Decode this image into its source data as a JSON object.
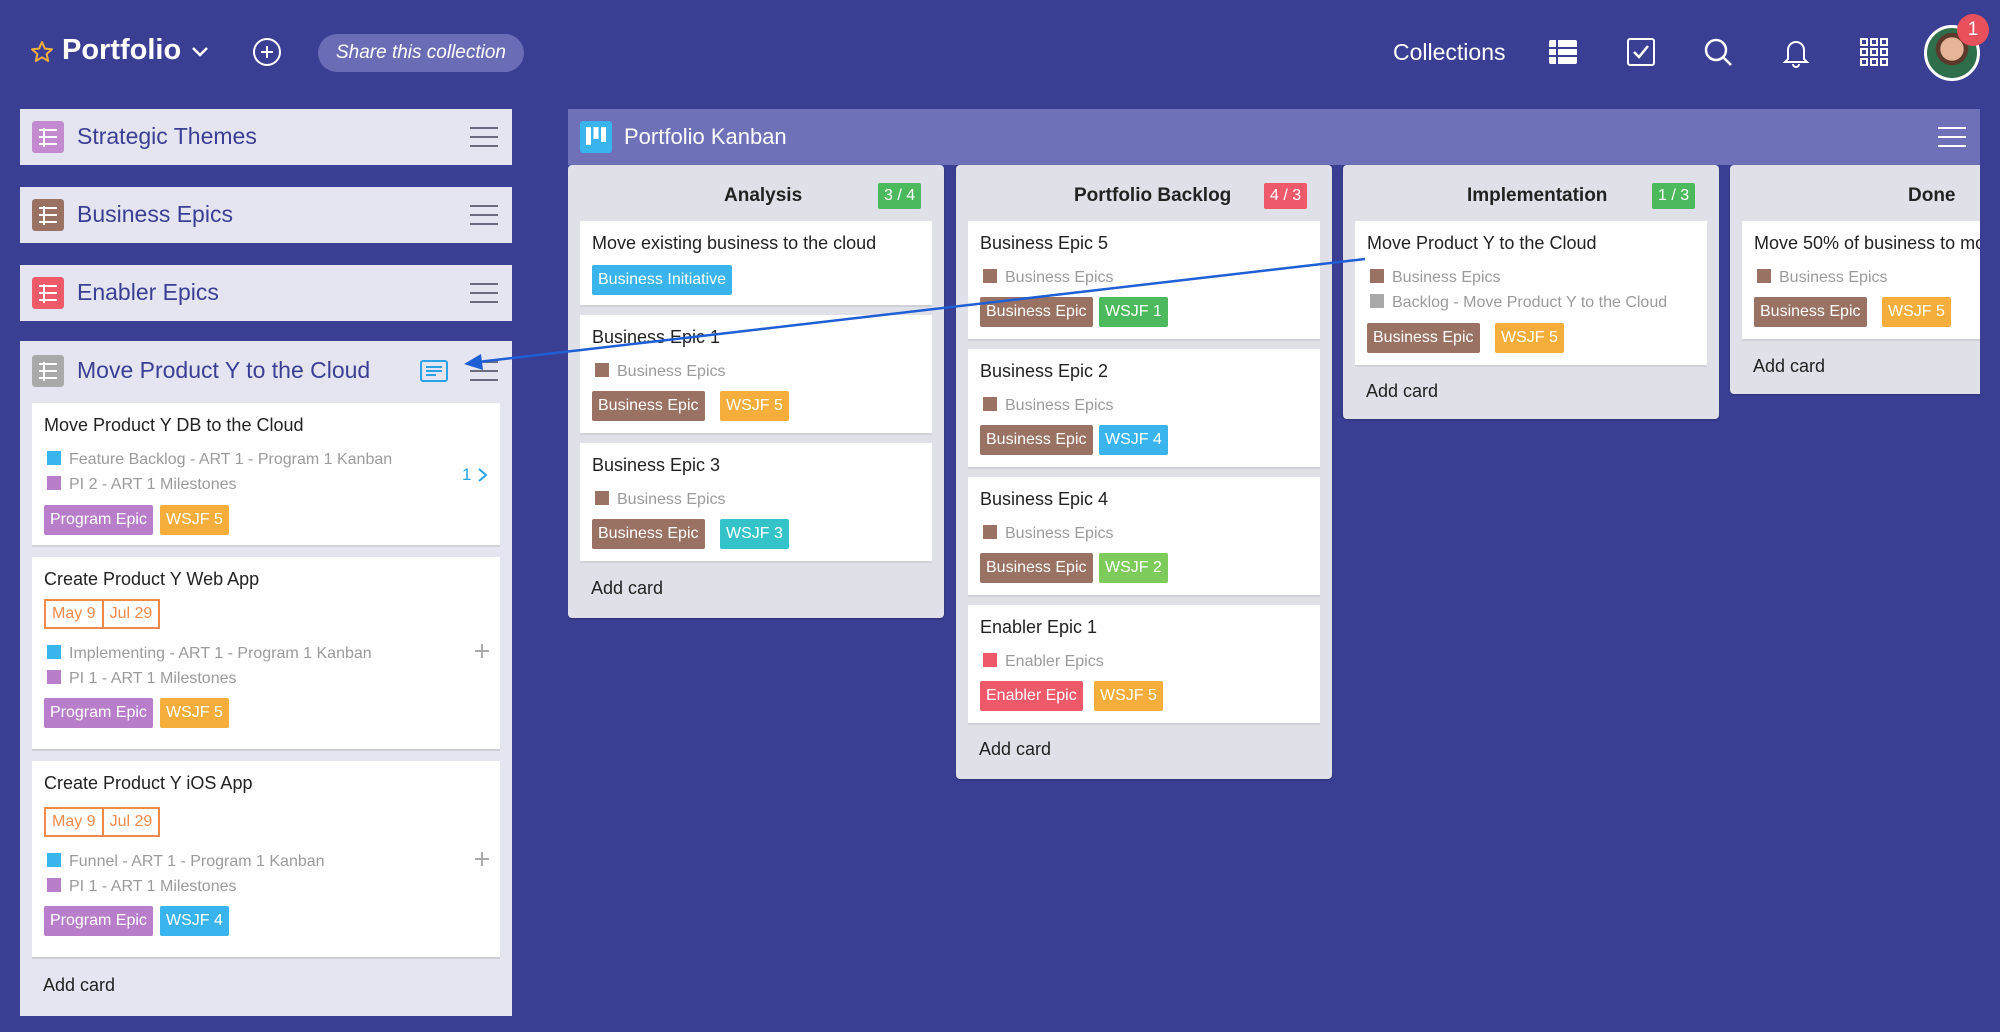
{
  "colors": {
    "background": "#3b3f94",
    "business_epic": "#9a7264",
    "enabler_epic": "#ef5a6a",
    "program_epic": "#b97ec9",
    "business_initiative": "#3ab4ec",
    "wsjf_orange": "#f5ae3b",
    "wsjf_green": "#4cba5c",
    "wsjf_blue": "#3ab4ec",
    "wsjf_teal": "#33c3c9",
    "wsjf_lime": "#7ccb5b",
    "wip_ok": "#4cba5c",
    "wip_over": "#ef5a6a",
    "connector": "#1e5fd6"
  },
  "header": {
    "title": "Portfolio",
    "share_label": "Share this collection",
    "collections_label": "Collections",
    "notification_count": "1",
    "icons": [
      "star-icon",
      "chevron-down-icon",
      "add-icon",
      "list-view-icon",
      "checkbox-icon",
      "search-icon",
      "bell-icon",
      "apps-grid-icon"
    ]
  },
  "sidebar": {
    "collapsed": [
      {
        "label": "Strategic Themes",
        "icon_color": "#c48ad0"
      },
      {
        "label": "Business Epics",
        "icon_color": "#9a7264"
      },
      {
        "label": "Enabler Epics",
        "icon_color": "#ef5a6a"
      }
    ],
    "expanded": {
      "label": "Move Product Y to the Cloud",
      "icon_color": "#a9a9a9",
      "cards": [
        {
          "title": "Move Product Y DB to the Cloud",
          "meta": [
            {
              "text": "Feature Backlog - ART 1 - Program 1 Kanban",
              "color": "#3ab4ec"
            },
            {
              "text": "PI 2 - ART 1 Milestones",
              "color": "#b97ec9"
            }
          ],
          "child_count": "1",
          "tags": [
            {
              "text": "Program Epic",
              "color": "#b97ec9"
            },
            {
              "text": "WSJF 5",
              "color": "#f5ae3b"
            }
          ]
        },
        {
          "title": "Create Product Y Web App",
          "dates": [
            "May 9",
            "Jul 29"
          ],
          "meta": [
            {
              "text": "Implementing - ART 1 - Program 1 Kanban",
              "color": "#3ab4ec"
            },
            {
              "text": "PI 1 - ART 1 Milestones",
              "color": "#b97ec9"
            }
          ],
          "tags": [
            {
              "text": "Program Epic",
              "color": "#b97ec9"
            },
            {
              "text": "WSJF 5",
              "color": "#f5ae3b"
            }
          ]
        },
        {
          "title": "Create Product Y iOS App",
          "dates": [
            "May 9",
            "Jul 29"
          ],
          "meta": [
            {
              "text": "Funnel - ART 1 - Program 1 Kanban",
              "color": "#3ab4ec"
            },
            {
              "text": "PI 1 - ART 1 Milestones",
              "color": "#b97ec9"
            }
          ],
          "tags": [
            {
              "text": "Program Epic",
              "color": "#b97ec9"
            },
            {
              "text": "WSJF 4",
              "color": "#3ab4ec"
            }
          ]
        }
      ],
      "add_card_label": "Add card"
    }
  },
  "board": {
    "title": "Portfolio Kanban",
    "add_card_label": "Add card",
    "columns": [
      {
        "title": "Analysis",
        "wip": "3 / 4",
        "wip_color": "#4cba5c",
        "cards": [
          {
            "title": "Move existing business to the cloud",
            "tags": [
              {
                "text": "Business Initiative",
                "color": "#3ab4ec"
              }
            ]
          },
          {
            "title": "Business Epic 1",
            "meta": [
              {
                "text": "Business Epics",
                "color": "#9a7264"
              }
            ],
            "tags": [
              {
                "text": "Business Epic",
                "color": "#9a7264"
              },
              {
                "text": "WSJF 5",
                "color": "#f5ae3b"
              }
            ]
          },
          {
            "title": "Business Epic 3",
            "meta": [
              {
                "text": "Business Epics",
                "color": "#9a7264"
              }
            ],
            "tags": [
              {
                "text": "Business Epic",
                "color": "#9a7264"
              },
              {
                "text": "WSJF 3",
                "color": "#33c3c9"
              }
            ]
          }
        ]
      },
      {
        "title": "Portfolio Backlog",
        "wip": "4 / 3",
        "wip_color": "#ef5a6a",
        "cards": [
          {
            "title": "Business Epic 5",
            "meta": [
              {
                "text": "Business Epics",
                "color": "#9a7264"
              }
            ],
            "tags": [
              {
                "text": "Business Epic",
                "color": "#9a7264"
              },
              {
                "text": "WSJF 1",
                "color": "#4cba5c"
              }
            ]
          },
          {
            "title": "Business Epic 2",
            "meta": [
              {
                "text": "Business Epics",
                "color": "#9a7264"
              }
            ],
            "tags": [
              {
                "text": "Business Epic",
                "color": "#9a7264"
              },
              {
                "text": "WSJF 4",
                "color": "#3ab4ec"
              }
            ]
          },
          {
            "title": "Business Epic 4",
            "meta": [
              {
                "text": "Business Epics",
                "color": "#9a7264"
              }
            ],
            "tags": [
              {
                "text": "Business Epic",
                "color": "#9a7264"
              },
              {
                "text": "WSJF 2",
                "color": "#7ccb5b"
              }
            ]
          },
          {
            "title": "Enabler Epic 1",
            "meta": [
              {
                "text": "Enabler Epics",
                "color": "#ef5a6a"
              }
            ],
            "tags": [
              {
                "text": "Enabler Epic",
                "color": "#ef5a6a"
              },
              {
                "text": "WSJF 5",
                "color": "#f5ae3b"
              }
            ]
          }
        ]
      },
      {
        "title": "Implementation",
        "wip": "1 / 3",
        "wip_color": "#4cba5c",
        "cards": [
          {
            "title": "Move Product Y to the Cloud",
            "meta": [
              {
                "text": "Business Epics",
                "color": "#9a7264"
              },
              {
                "text": "Backlog - Move Product Y to the Cloud",
                "color": "#a9a9a9"
              }
            ],
            "tags": [
              {
                "text": "Business Epic",
                "color": "#9a7264"
              },
              {
                "text": "WSJF 5",
                "color": "#f5ae3b"
              }
            ]
          }
        ]
      },
      {
        "title": "Done",
        "cards": [
          {
            "title": "Move 50% of business to mo",
            "meta": [
              {
                "text": "Business Epics",
                "color": "#9a7264"
              }
            ],
            "tags": [
              {
                "text": "Business Epic",
                "color": "#9a7264"
              },
              {
                "text": "WSJF 5",
                "color": "#f5ae3b"
              }
            ]
          }
        ]
      }
    ]
  }
}
